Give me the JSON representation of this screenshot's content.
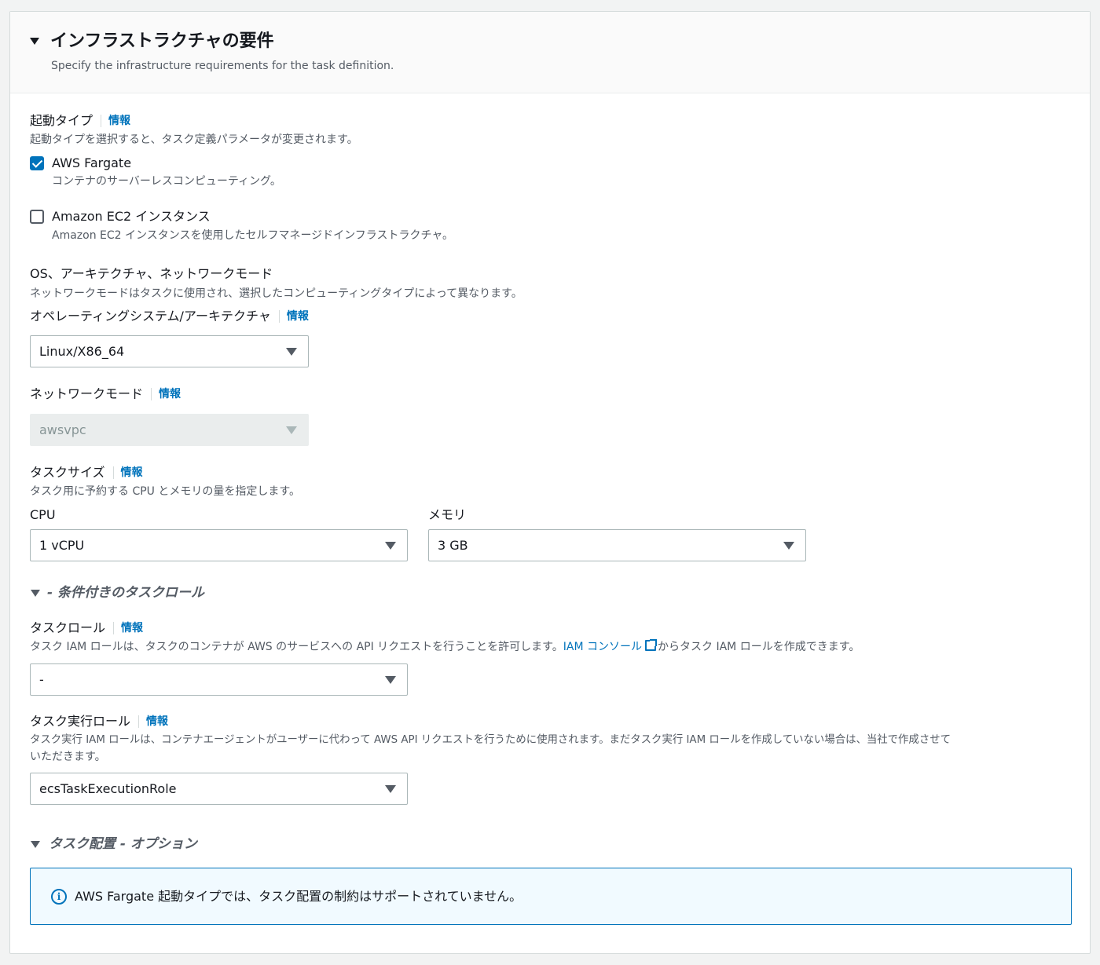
{
  "section": {
    "title": "インフラストラクチャの要件",
    "description": "Specify the infrastructure requirements for the task definition."
  },
  "launch_type": {
    "label": "起動タイプ",
    "info": "情報",
    "description": "起動タイプを選択すると、タスク定義パラメータが変更されます。",
    "options": [
      {
        "label": "AWS Fargate",
        "description": "コンテナのサーバーレスコンピューティング。",
        "checked": true
      },
      {
        "label": "Amazon EC2 インスタンス",
        "description": "Amazon EC2 インスタンスを使用したセルフマネージドインフラストラクチャ。",
        "checked": false
      }
    ]
  },
  "os_network": {
    "heading": "OS、アーキテクチャ、ネットワークモード",
    "description": "ネットワークモードはタスクに使用され、選択したコンピューティングタイプによって異なります。",
    "os_label": "オペレーティングシステム/アーキテクチャ",
    "os_info": "情報",
    "os_value": "Linux/X86_64",
    "network_label": "ネットワークモード",
    "network_info": "情報",
    "network_value": "awsvpc"
  },
  "task_size": {
    "label": "タスクサイズ",
    "info": "情報",
    "description": "タスク用に予約する CPU とメモリの量を指定します。",
    "cpu_label": "CPU",
    "cpu_value": "1 vCPU",
    "memory_label": "メモリ",
    "memory_value": "3 GB"
  },
  "task_role_section": {
    "title": "- 条件付きのタスクロール",
    "task_role_label": "タスクロール",
    "task_role_info": "情報",
    "task_role_desc_before": "タスク IAM ロールは、タスクのコンテナが AWS のサービスへの API リクエストを行うことを許可します。",
    "task_role_link": "IAM コンソール",
    "task_role_desc_after": "からタスク IAM ロールを作成できます。",
    "task_role_value": "-",
    "exec_role_label": "タスク実行ロール",
    "exec_role_info": "情報",
    "exec_role_desc_line1": "タスク実行 IAM ロールは、コンテナエージェントがユーザーに代わって AWS API リクエストを行うために使用されます。まだタスク実行 IAM ロールを作成していない場合は、当社で作成させて",
    "exec_role_desc_line2": "いただきます。",
    "exec_role_value": "ecsTaskExecutionRole"
  },
  "placement": {
    "title": "タスク配置 - オプション",
    "alert_text": "AWS Fargate 起動タイプでは、タスク配置の制約はサポートされていません。"
  },
  "colors": {
    "link": "#0073bb",
    "alert_bg": "#f1faff",
    "header_bg": "#fafafa"
  }
}
